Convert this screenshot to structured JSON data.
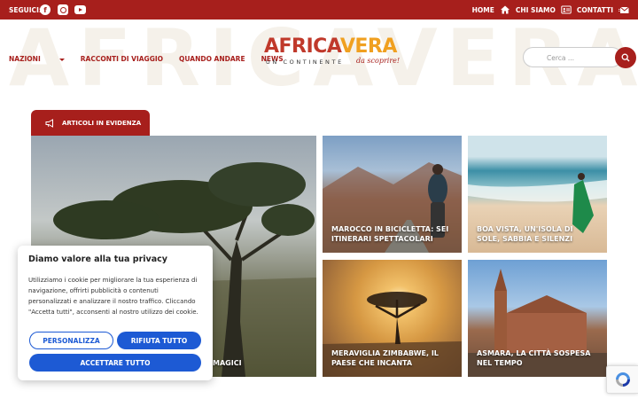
{
  "topbar": {
    "follow_label": "SEGUICI:",
    "social": [
      {
        "icon": "facebook-icon"
      },
      {
        "icon": "instagram-icon"
      },
      {
        "icon": "youtube-icon"
      }
    ],
    "links": [
      {
        "label": "HOME",
        "icon": "home-icon"
      },
      {
        "label": "CHI SIAMO",
        "icon": "id-card-icon"
      },
      {
        "label": "CONTATTI",
        "icon": "mail-icon"
      }
    ]
  },
  "header": {
    "background_word": "AFRICAVERA",
    "nav": [
      "NAZIONI",
      "RACCONTI DI VIAGGIO",
      "QUANDO ANDARE",
      "NEWS"
    ],
    "logo": {
      "part1": "AFRICA",
      "part2": "VERA",
      "subtitle": "UN CONTINENTE",
      "script": "da scoprire!"
    },
    "search_placeholder": "Cerca ..."
  },
  "featured": {
    "tab_label": "ARTICOLI IN EVIDENZA",
    "articles": [
      {
        "title": "MAGICI"
      },
      {
        "title": "MAROCCO IN BICICLETTA: SEI ITINERARI SPETTACOLARI"
      },
      {
        "title": "BOA VISTA, UN'ISOLA DI SOLE, SABBIA E SILENZI"
      },
      {
        "title": "MERAVIGLIA ZIMBABWE, IL PAESE CHE INCANTA"
      },
      {
        "title": "ASMARA, LA CITTÀ SOSPESA NEL TEMPO"
      }
    ]
  },
  "cookie_banner": {
    "title": "Diamo valore alla tua privacy",
    "text": "Utilizziamo i cookie per migliorare la tua esperienza di navigazione, offrirti pubblicità o contenuti personalizzati e analizzare il nostro traffico. Cliccando \"Accetta tutti\", acconsenti al nostro utilizzo dei cookie.",
    "customize_label": "PERSONALIZZA",
    "reject_label": "RIFIUTA TUTTO",
    "accept_label": "ACCETTARE TUTTO"
  },
  "colors": {
    "brand_red": "#a71f1c",
    "cookie_blue": "#1d5ad4",
    "logo_orange": "#f0a020"
  }
}
